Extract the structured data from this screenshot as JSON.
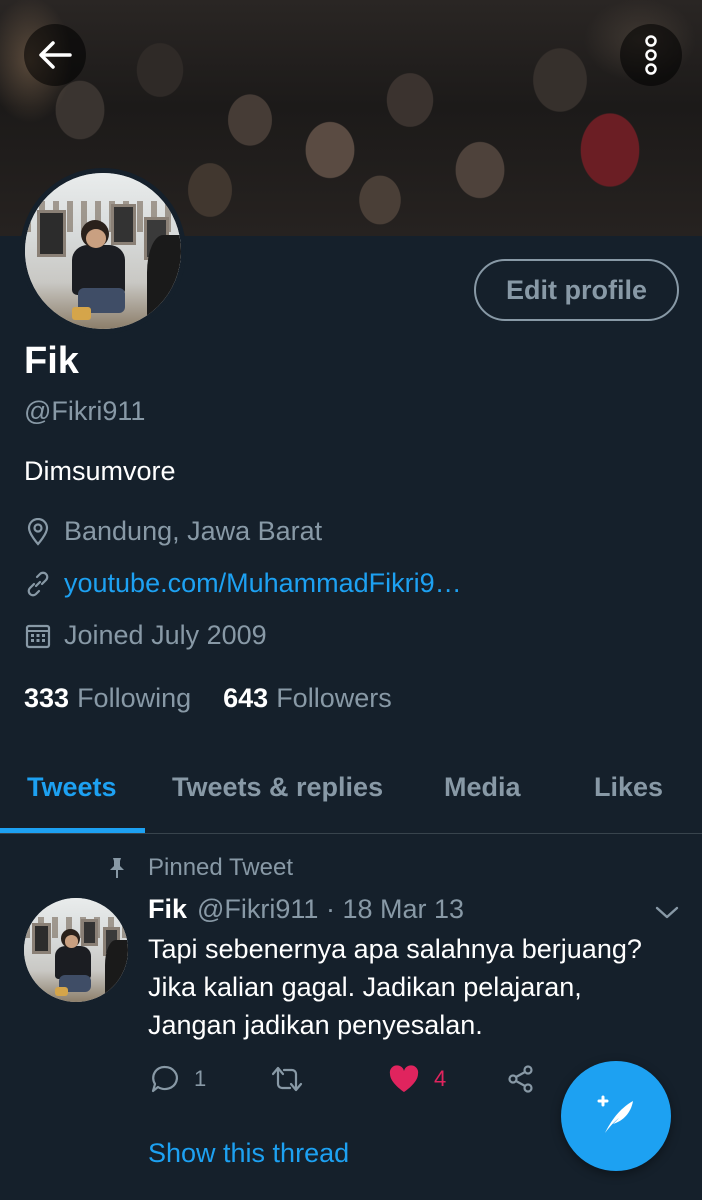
{
  "header": {
    "back_icon": "arrow-left-icon",
    "more_icon": "more-vertical-icon"
  },
  "profile": {
    "edit_label": "Edit profile",
    "name": "Fik",
    "handle": "@Fikri911",
    "bio": "Dimsumvore",
    "location": "Bandung, Jawa Barat",
    "website": "youtube.com/MuhammadFikri9…",
    "joined": "Joined July 2009",
    "following_count": "333",
    "following_label": "Following",
    "followers_count": "643",
    "followers_label": "Followers"
  },
  "tabs": [
    {
      "label": "Tweets",
      "active": true
    },
    {
      "label": "Tweets & replies",
      "active": false
    },
    {
      "label": "Media",
      "active": false
    },
    {
      "label": "Likes",
      "active": false
    }
  ],
  "tweet": {
    "pinned_label": "Pinned Tweet",
    "name": "Fik",
    "handle_date": "@Fikri911 · 18 Mar 13",
    "lines": [
      "Tapi sebenernya apa salahnya berjuang?",
      "Jika kalian gagal. Jadikan pelajaran,",
      "Jangan jadikan penyesalan."
    ],
    "reply_count": "1",
    "retweet_count": "",
    "like_count": "4",
    "show_thread": "Show this thread"
  },
  "colors": {
    "background": "#15202b",
    "accent": "#1da1f2",
    "secondary_text": "#8899a6",
    "like": "#e0245e",
    "divider": "#38444d"
  }
}
